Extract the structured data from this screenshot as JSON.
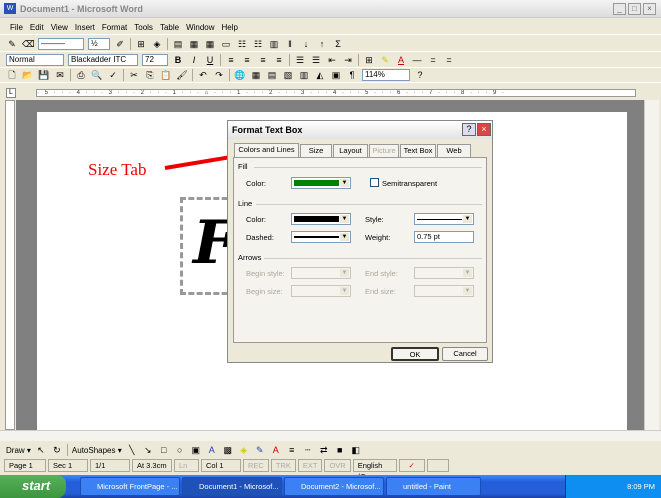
{
  "window": {
    "title": "Document1 - Microsoft Word"
  },
  "menu": [
    "File",
    "Edit",
    "View",
    "Insert",
    "Format",
    "Tools",
    "Table",
    "Window",
    "Help"
  ],
  "formatting": {
    "style": "Normal",
    "font": "Blackadder ITC",
    "size": "72"
  },
  "standard": {
    "zoom": "114%"
  },
  "ruler": {
    "ticks": "· 5 · · · 4 · · · 3 · · · 2 · · · 1 · · · ⌂ · · · 1 · · · 2 · · · 3 · · · 4 · · · 5 · · · 6 · · · 7 · · · 8 · · · 9 ·"
  },
  "document": {
    "textbox_letter": "F"
  },
  "annotation": {
    "text": "Size Tab",
    "color": "#e00000"
  },
  "dialog": {
    "title": "Format Text Box",
    "tabs": [
      "Colors and Lines",
      "Size",
      "Layout",
      "Picture",
      "Text Box",
      "Web"
    ],
    "active_tab": "Colors and Lines",
    "fill": {
      "header": "Fill",
      "color_label": "Color:",
      "color_value": "#008000",
      "semitransparent_label": "Semitransparent",
      "semitransparent_checked": false
    },
    "line": {
      "header": "Line",
      "color_label": "Color:",
      "color_value": "#000000",
      "style_label": "Style:",
      "dashed_label": "Dashed:",
      "weight_label": "Weight:",
      "weight_value": "0.75 pt"
    },
    "arrows": {
      "header": "Arrows",
      "begin_style": "Begin style:",
      "end_style": "End style:",
      "begin_size": "Begin size:",
      "end_size": "End size:"
    },
    "ok": "OK",
    "cancel": "Cancel"
  },
  "drawing": {
    "draw": "Draw ▾",
    "autoshapes": "AutoShapes ▾"
  },
  "status": {
    "page": "Page 1",
    "sec": "Sec 1",
    "pages": "1/1",
    "at": "At 3.3cm",
    "ln": "Ln",
    "col": "Col 1",
    "rec": "REC",
    "trk": "TRK",
    "ext": "EXT",
    "ovr": "OVR",
    "lang": "English (Ca"
  },
  "taskbar": {
    "start": "start",
    "tasks": [
      "Microsoft FrontPage - ...",
      "Document1 - Microsof...",
      "Document2 - Microsof...",
      "untitled - Paint"
    ],
    "clock": "8:09 PM"
  }
}
